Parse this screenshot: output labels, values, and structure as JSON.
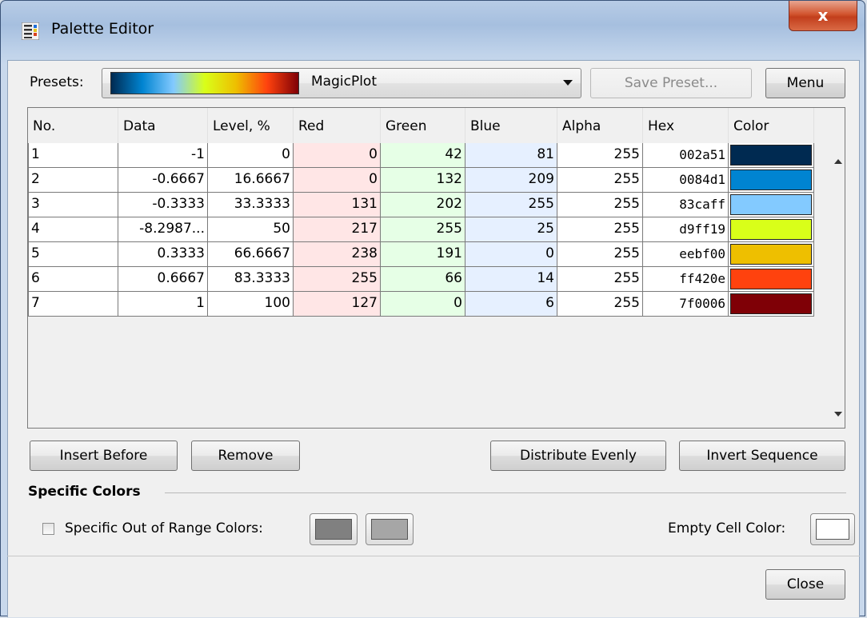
{
  "window": {
    "title": "Palette Editor",
    "close_glyph": "x"
  },
  "presets": {
    "label": "Presets:",
    "selected": "MagicPlot",
    "save_label": "Save Preset...",
    "menu_label": "Menu",
    "gradient_colors": [
      "#002a51",
      "#0084d1",
      "#83caff",
      "#d9ff19",
      "#eebf00",
      "#ff420e",
      "#7f0006"
    ]
  },
  "table": {
    "columns": [
      "No.",
      "Data",
      "Level, %",
      "Red",
      "Green",
      "Blue",
      "Alpha",
      "Hex",
      "Color"
    ],
    "rows": [
      {
        "no": "1",
        "data": "-1",
        "level": "0",
        "red": "0",
        "green": "42",
        "blue": "81",
        "alpha": "255",
        "hex": "002a51",
        "color": "#002a51"
      },
      {
        "no": "2",
        "data": "-0.6667",
        "level": "16.6667",
        "red": "0",
        "green": "132",
        "blue": "209",
        "alpha": "255",
        "hex": "0084d1",
        "color": "#0084d1"
      },
      {
        "no": "3",
        "data": "-0.3333",
        "level": "33.3333",
        "red": "131",
        "green": "202",
        "blue": "255",
        "alpha": "255",
        "hex": "83caff",
        "color": "#83caff"
      },
      {
        "no": "4",
        "data": "-8.2987...",
        "level": "50",
        "red": "217",
        "green": "255",
        "blue": "25",
        "alpha": "255",
        "hex": "d9ff19",
        "color": "#d9ff19"
      },
      {
        "no": "5",
        "data": "0.3333",
        "level": "66.6667",
        "red": "238",
        "green": "191",
        "blue": "0",
        "alpha": "255",
        "hex": "eebf00",
        "color": "#eebf00"
      },
      {
        "no": "6",
        "data": "0.6667",
        "level": "83.3333",
        "red": "255",
        "green": "66",
        "blue": "14",
        "alpha": "255",
        "hex": "ff420e",
        "color": "#ff420e"
      },
      {
        "no": "7",
        "data": "1",
        "level": "100",
        "red": "127",
        "green": "0",
        "blue": "6",
        "alpha": "255",
        "hex": "7f0006",
        "color": "#7f0006"
      }
    ]
  },
  "actions": {
    "insert_before": "Insert Before",
    "remove": "Remove",
    "distribute_evenly": "Distribute Evenly",
    "invert_sequence": "Invert Sequence"
  },
  "specific_colors": {
    "title": "Specific Colors",
    "out_of_range_label": "Specific Out of Range Colors:",
    "out_of_range_checked": false,
    "low_color": "#808080",
    "high_color": "#a6a6a6",
    "empty_cell_label": "Empty Cell Color:",
    "empty_cell_color": "#ffffff"
  },
  "footer": {
    "close_label": "Close"
  }
}
